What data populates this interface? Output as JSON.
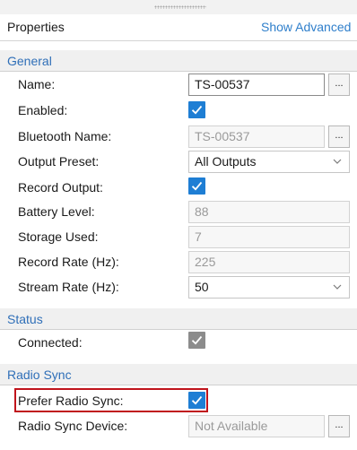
{
  "panel": {
    "title": "Properties",
    "show_advanced_label": "Show Advanced"
  },
  "general": {
    "title": "General",
    "name_label": "Name:",
    "name_value": "TS-00537",
    "enabled_label": "Enabled:",
    "enabled_checked": true,
    "bluetooth_label": "Bluetooth Name:",
    "bluetooth_value": "TS-00537",
    "output_preset_label": "Output Preset:",
    "output_preset_value": "All Outputs",
    "record_output_label": "Record Output:",
    "record_output_checked": true,
    "battery_label": "Battery Level:",
    "battery_value": "88",
    "storage_label": "Storage Used:",
    "storage_value": "7",
    "record_rate_label": "Record Rate (Hz):",
    "record_rate_value": "225",
    "stream_rate_label": "Stream Rate (Hz):",
    "stream_rate_value": "50"
  },
  "status": {
    "title": "Status",
    "connected_label": "Connected:",
    "connected_checked": true
  },
  "radio_sync": {
    "title": "Radio Sync",
    "prefer_label": "Prefer Radio Sync:",
    "prefer_checked": true,
    "device_label": "Radio Sync Device:",
    "device_value": "Not Available"
  },
  "ellipsis_label": "...",
  "colors": {
    "accent": "#1e7ed4",
    "link": "#2f7fcb",
    "section_text": "#2f6fb8",
    "highlight": "#c0141c",
    "disabled_check": "#8c8c8c"
  }
}
